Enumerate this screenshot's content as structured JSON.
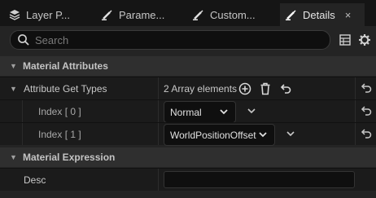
{
  "tabs": [
    {
      "label": "Layer P...",
      "icon": "layers-icon",
      "active": false
    },
    {
      "label": "Parame...",
      "icon": "brush-icon",
      "active": false
    },
    {
      "label": "Custom...",
      "icon": "brush-icon",
      "active": false
    },
    {
      "label": "Details",
      "icon": "brush-icon",
      "active": true
    }
  ],
  "tab_close": "×",
  "search": {
    "placeholder": "Search"
  },
  "categories": {
    "attributes": "Material Attributes",
    "expression": "Material Expression"
  },
  "properties": {
    "get_types": {
      "label": "Attribute Get Types",
      "value": "2 Array elements"
    },
    "index0": {
      "label": "Index [ 0 ]",
      "value": "Normal"
    },
    "index1": {
      "label": "Index [ 1 ]",
      "value": "WorldPositionOffset"
    },
    "desc": {
      "label": "Desc",
      "value": ""
    }
  },
  "colors": {
    "panel": "#242424",
    "row": "#1b1b1b",
    "category": "#2f2f2f",
    "input": "#0f0f0f"
  }
}
